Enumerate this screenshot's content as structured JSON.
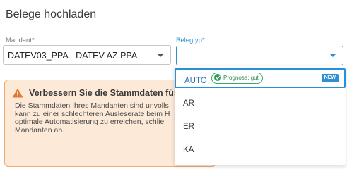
{
  "page": {
    "title": "Belege hochladen"
  },
  "form": {
    "mandant": {
      "label": "Mandant*",
      "value": "DATEV03_PPA - DATEV AZ PPA"
    },
    "belegtyp": {
      "label": "Belegtyp*",
      "value": ""
    }
  },
  "warning": {
    "heading": "Verbessern Sie die Stammdaten für diese",
    "body": "Die Stammdaten Ihres Mandanten sind unvolls\nkann zu einer schlechteren Ausleserate beim H\noptimale Automatisierung zu erreichen, schlie\nMandanten ab."
  },
  "dropdown": {
    "options": [
      {
        "label": "AUTO",
        "badge": "Prognose: gut",
        "tag": "NEW"
      },
      {
        "label": "AR"
      },
      {
        "label": "ER"
      },
      {
        "label": "KA"
      }
    ]
  },
  "colors": {
    "accent": "#2f8fd3",
    "warning_bg": "#fde9d8",
    "warning_border": "#f2a86e",
    "success": "#2d9e55"
  }
}
